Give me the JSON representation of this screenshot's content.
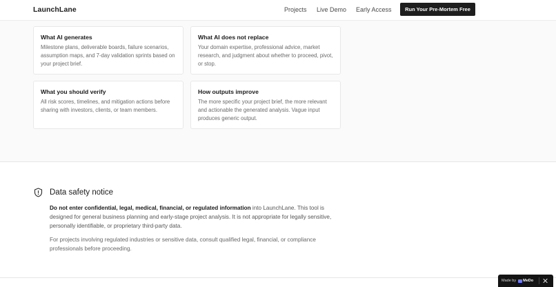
{
  "header": {
    "brand": "LaunchLane",
    "nav": {
      "projects": "Projects",
      "live_demo": "Live Demo",
      "early_access": "Early Access"
    },
    "cta_label": "Run Your Pre-Mortem Free"
  },
  "cards": [
    {
      "title": "What AI generates",
      "body": "Milestone plans, deliverable boards, failure scenarios, assumption maps, and 7-day validation sprints based on your project brief."
    },
    {
      "title": "What AI does not replace",
      "body": "Your domain expertise, professional advice, market research, and judgment about whether to proceed, pivot, or stop."
    },
    {
      "title": "What you should verify",
      "body": "All risk scores, timelines, and mitigation actions before sharing with investors, clients, or team members."
    },
    {
      "title": "How outputs improve",
      "body": "The more specific your project brief, the more relevant and actionable the generated analysis. Vague input produces generic output."
    }
  ],
  "safety": {
    "icon": "shield-icon",
    "title": "Data safety notice",
    "para1_strong": "Do not enter confidential, legal, medical, financial, or regulated information",
    "para1_rest": " into LaunchLane. This tool is designed for general business planning and early-stage project analysis. It is not appropriate for legally sensitive, personally identifiable, or proprietary third-party data.",
    "para2": "For projects involving regulated industries or sensitive data, consult qualified legal, financial, or compliance professionals before proceeding."
  },
  "badge": {
    "made_by": "Made by",
    "brand": "MeDo"
  },
  "colors": {
    "cta_bg": "#1e1e1e",
    "section_bg": "#fafafa",
    "badge_bg": "#141414",
    "logo_accent": "#6f7cff"
  }
}
